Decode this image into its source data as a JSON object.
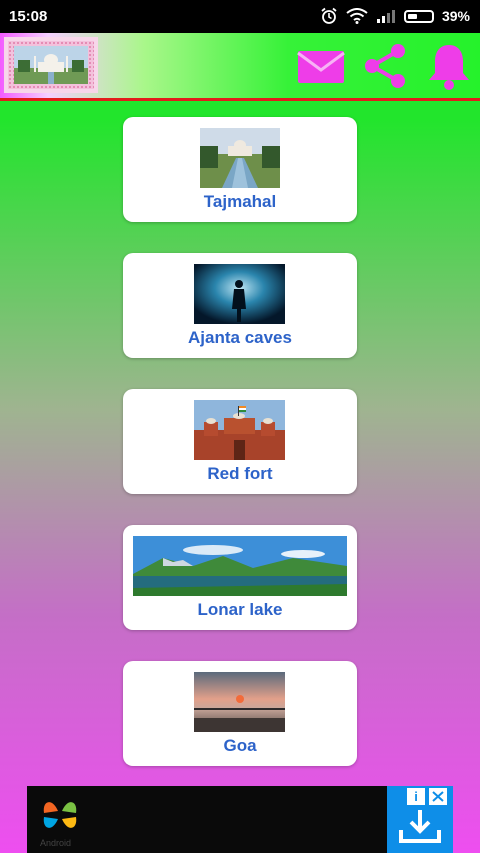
{
  "status_bar": {
    "time": "15:08",
    "battery_percent": "39%",
    "icons": [
      "alarm-icon",
      "wifi-icon",
      "signal-icon",
      "battery-icon"
    ]
  },
  "app_bar": {
    "icons": [
      "mail-icon",
      "share-icon",
      "bell-icon"
    ],
    "accent_color": "#ee3de8"
  },
  "places": [
    {
      "name": "Tajmahal"
    },
    {
      "name": "Ajanta caves"
    },
    {
      "name": "Red fort"
    },
    {
      "name": "Lonar lake"
    },
    {
      "name": "Goa"
    }
  ],
  "colors": {
    "label": "#2d63c9",
    "app_bar_border": "#e21c1c",
    "ad_cta": "#0e8ee8"
  },
  "ad": {
    "logo_text": "Android",
    "icons": [
      "info-icon",
      "close-icon",
      "download-icon"
    ]
  }
}
